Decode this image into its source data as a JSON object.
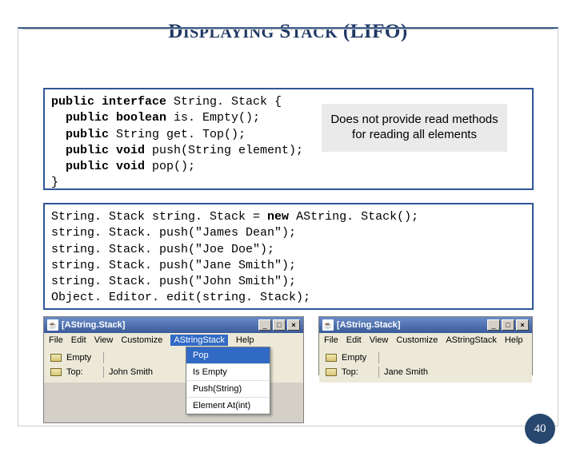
{
  "title": {
    "w1a": "D",
    "w1b": "ISPLAYING",
    "w2a": "S",
    "w2b": "TACK",
    "w3": "(LIFO)"
  },
  "code1": {
    "l1a": "public",
    "l1b": " interface",
    "l1c": " String. Stack {",
    "l2a": "  public",
    "l2b": " boolean",
    "l2c": " is. Empty();",
    "l3a": "  public",
    "l3b": " String get. Top();",
    "l4a": "  public",
    "l4b": " void",
    "l4c": " push(String element);",
    "l5a": "  public",
    "l5b": " void",
    "l5c": " pop();",
    "l6": "}"
  },
  "callout": "Does not provide read methods for reading all elements",
  "code2": {
    "l1a": "String. Stack string. Stack = ",
    "l1b": "new",
    "l1c": " AString. Stack();",
    "l2": "string. Stack. push(\"James Dean\");",
    "l3": "string. Stack. push(\"Joe Doe\");",
    "l4": "string. Stack. push(\"Jane Smith\");",
    "l5": "string. Stack. push(\"John Smith\");",
    "l6": "Object. Editor. edit(string. Stack);"
  },
  "win1": {
    "title": "[AString.Stack]",
    "menu": {
      "file": "File",
      "edit": "Edit",
      "view": "View",
      "customize": "Customize",
      "astack": "AStringStack",
      "help": "Help"
    },
    "row1": {
      "label": "Empty"
    },
    "row2": {
      "label": "Top:",
      "value": "John Smith"
    }
  },
  "dropdown": {
    "i1": "Pop",
    "i2": "Is Empty",
    "i3": "Push(String)",
    "i4": "Element At(int)"
  },
  "win2": {
    "title": "[AString.Stack]",
    "menu": {
      "file": "File",
      "edit": "Edit",
      "view": "View",
      "customize": "Customize",
      "astack": "AStringStack",
      "help": "Help"
    },
    "row1": {
      "label": "Empty"
    },
    "row2": {
      "label": "Top:",
      "value": "Jane Smith"
    }
  },
  "page_number": "40",
  "icons": {
    "java": "☕",
    "min": "_",
    "max": "□",
    "close": "×"
  }
}
